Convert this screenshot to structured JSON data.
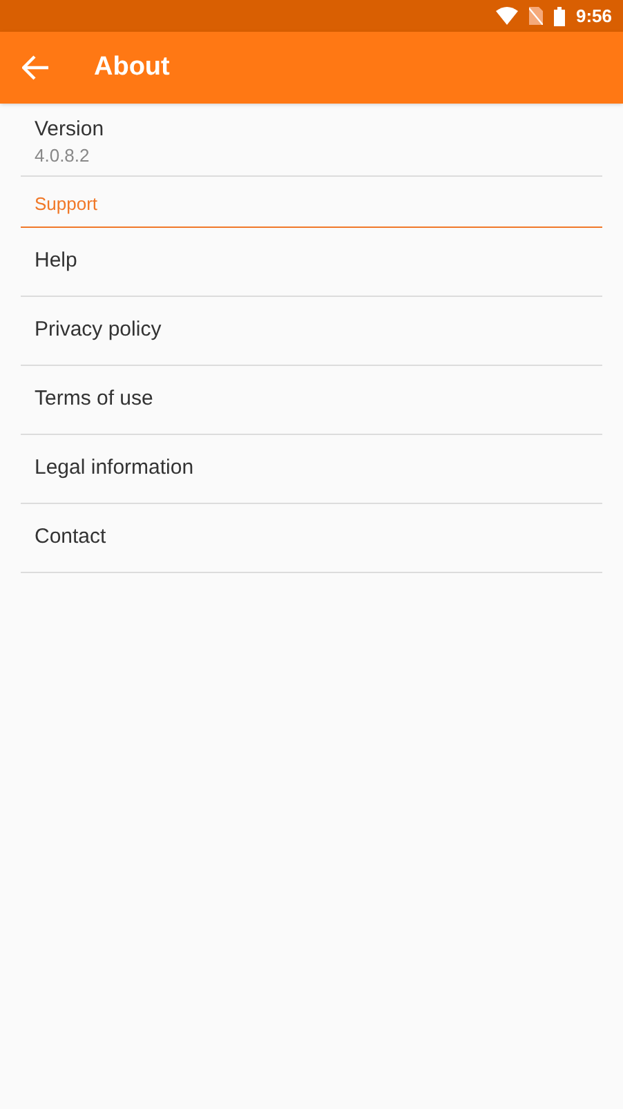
{
  "status_bar": {
    "time": "9:56"
  },
  "app_bar": {
    "title": "About"
  },
  "version": {
    "label": "Version",
    "value": "4.0.8.2"
  },
  "section": {
    "title": "Support"
  },
  "items": [
    {
      "label": "Help"
    },
    {
      "label": "Privacy policy"
    },
    {
      "label": "Terms of use"
    },
    {
      "label": "Legal information"
    },
    {
      "label": "Contact"
    }
  ]
}
